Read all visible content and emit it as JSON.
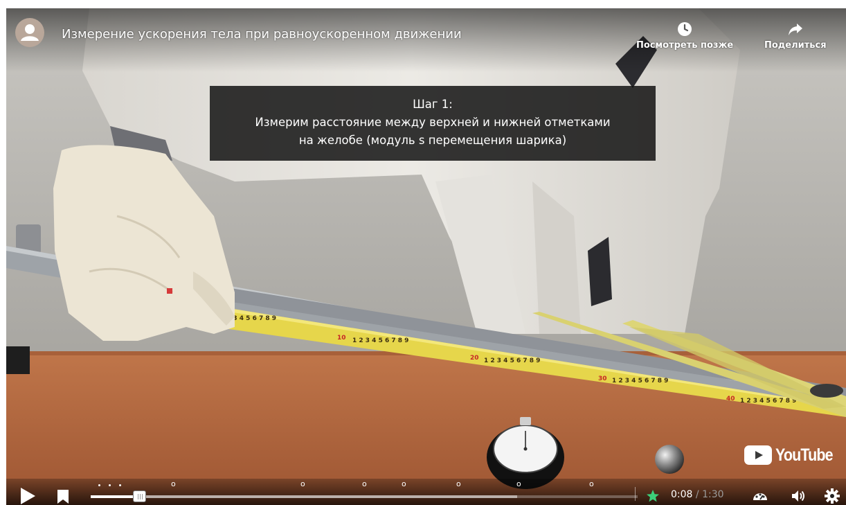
{
  "player": {
    "title": "Измерение ускорения тела при равноускоренном движении",
    "watch_later_label": "Посмотреть позже",
    "share_label": "Поделиться",
    "caption_lines": [
      "Шаг 1:",
      "Измерим расстояние между верхней и нижней отметками",
      "на желобе (модуль s перемещения шарика)"
    ],
    "logo_text": "YouTube",
    "time_current": "0:08",
    "time_separator": "/",
    "time_duration": "1:30",
    "played_fraction": 0.089,
    "buffered_fraction": 0.78,
    "chapter_marker": "o"
  },
  "colors": {
    "accent_progress": "#ffffff",
    "caption_bg": "#141414",
    "tape_yellow": "#e8d94a",
    "table_wood": "#b0623a"
  },
  "icons": {
    "watch_later": "clock-icon",
    "share": "share-arrow-icon",
    "play": "play-icon",
    "bookmark": "bookmark-icon",
    "favorite": "star-icon",
    "speed": "gauge-icon",
    "volume": "speaker-icon",
    "settings": "gear-icon"
  }
}
